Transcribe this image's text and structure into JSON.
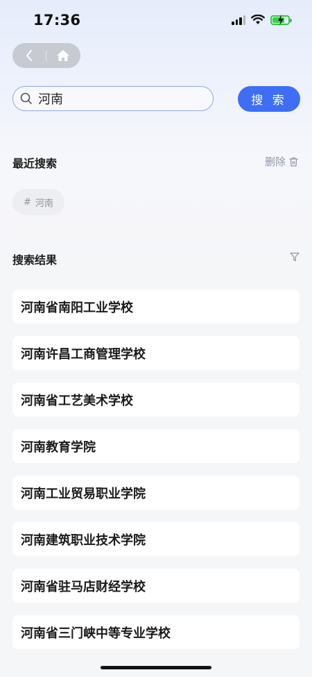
{
  "status_bar": {
    "time": "17:36"
  },
  "search": {
    "query": "河南",
    "button_label": "搜 索"
  },
  "recent": {
    "title": "最近搜索",
    "delete_label": "删除",
    "tags": [
      "河南"
    ],
    "tag_prefix": "#"
  },
  "results": {
    "title": "搜索结果",
    "items": [
      "河南省南阳工业学校",
      "河南许昌工商管理学校",
      "河南省工艺美术学校",
      "河南教育学院",
      "河南工业贸易职业学院",
      "河南建筑职业技术学院",
      "河南省驻马店财经学校",
      "河南省三门峡中等专业学校"
    ]
  },
  "colors": {
    "accent": "#3e6ef5",
    "search_border": "#8ea6ee",
    "battery": "#35d04a"
  },
  "icons": [
    "signal-icon",
    "wifi-icon",
    "battery-charging-icon",
    "chevron-left-icon",
    "home-icon",
    "search-icon",
    "trash-icon",
    "filter-icon"
  ]
}
